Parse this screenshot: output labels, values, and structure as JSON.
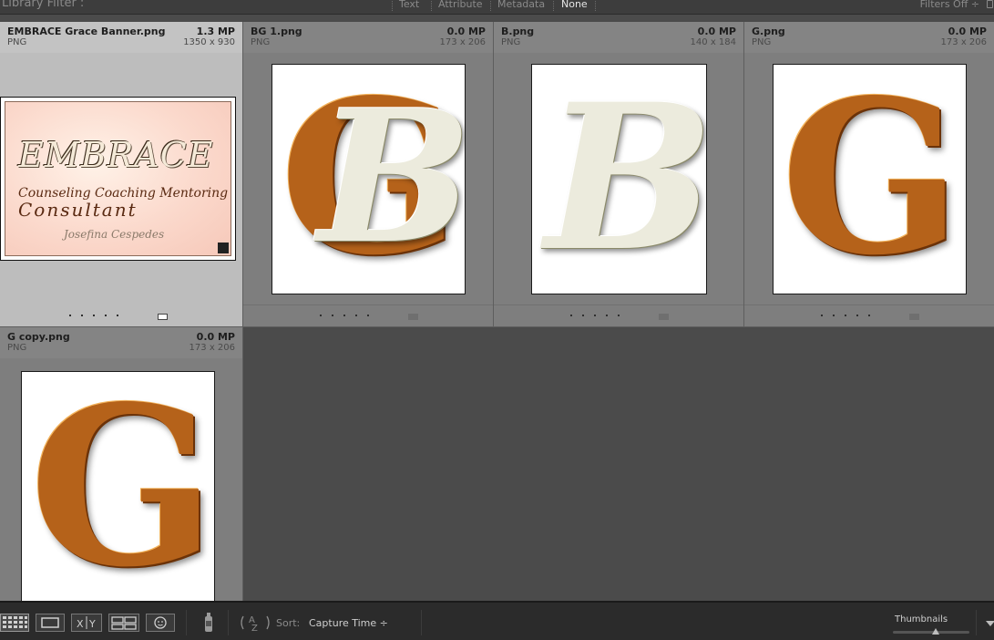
{
  "filter_bar": {
    "title": "Library Filter :",
    "options": [
      "Text",
      "Attribute",
      "Metadata",
      "None"
    ],
    "active_option": "None",
    "filters_status": "Filters Off ÷",
    "lock_icon": "lock-icon"
  },
  "grid": {
    "items": [
      {
        "name": "EMBRACE Grace Banner.png",
        "megapixels": "1.3 MP",
        "type": "PNG",
        "dimensions": "1350 x 930",
        "selected": true,
        "banner": {
          "title": "EMBRACE",
          "line1": "Counseling Coaching Mentoring",
          "line2": "Consultant",
          "line3": "Josefina Cespedes"
        }
      },
      {
        "name": "BG 1.png",
        "megapixels": "0.0 MP",
        "type": "PNG",
        "dimensions": "173 x 206",
        "selected": false
      },
      {
        "name": "B.png",
        "megapixels": "0.0 MP",
        "type": "PNG",
        "dimensions": "140 x 184",
        "selected": false
      },
      {
        "name": "G.png",
        "megapixels": "0.0 MP",
        "type": "PNG",
        "dimensions": "173 x 206",
        "selected": false
      },
      {
        "name": "G copy.png",
        "megapixels": "0.0 MP",
        "type": "PNG",
        "dimensions": "173 x 206",
        "selected": false
      }
    ]
  },
  "toolbar": {
    "view_buttons": [
      "grid-view-icon",
      "loupe-view-icon",
      "compare-view-icon",
      "survey-view-icon",
      "people-view-icon"
    ],
    "compare_label": "X Y",
    "spray_icon": "painter-spray-icon",
    "sort_direction_icon": "sort-az-icon",
    "sort_label": "Sort:",
    "sort_value": "Capture Time ÷",
    "thumbnails_label": "Thumbnails",
    "thumbnail_size": 0.55
  }
}
